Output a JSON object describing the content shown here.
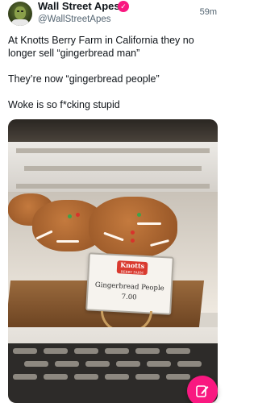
{
  "post": {
    "display_name": "Wall Street Apes",
    "handle": "@WallStreetApes",
    "timestamp": "59m",
    "verified_icon": "verified-badge-icon",
    "text_lines": [
      "At Knotts Berry Farm in California they no longer sell “gingerbread man”",
      "They’re now “gingerbread people”",
      "Woke is so f*cking stupid"
    ]
  },
  "media": {
    "sign_brand": "Knotts",
    "sign_brand_sub": "BERRY FARM",
    "sign_title": "Gingerbread People",
    "sign_price": "7.00"
  },
  "fab": {
    "icon": "compose-icon",
    "color": "#f91880"
  },
  "colors": {
    "accent": "#f91880",
    "secondary_text": "#536471"
  }
}
